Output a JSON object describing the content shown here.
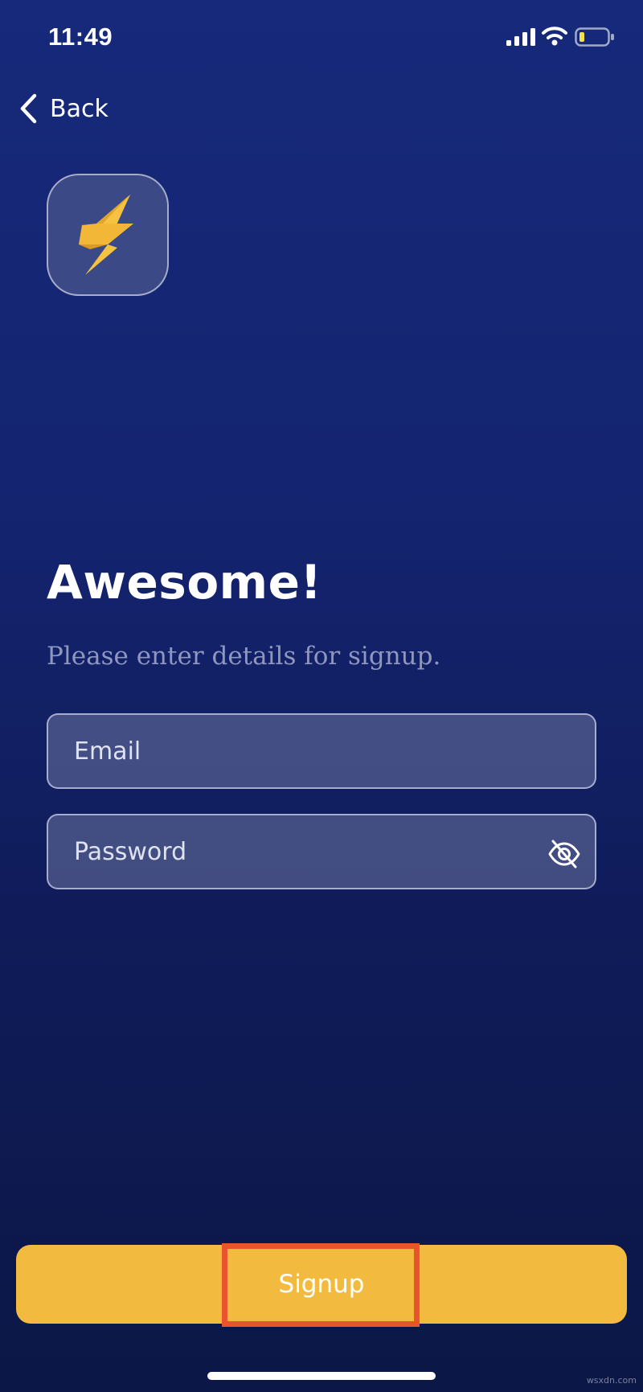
{
  "status_bar": {
    "time": "11:49",
    "icons": [
      "signal-icon",
      "wifi-icon",
      "battery-icon"
    ],
    "battery_color": "#f2e14a"
  },
  "nav": {
    "back_label": "Back",
    "back_icon": "chevron-left-icon"
  },
  "logo": {
    "icon": "lightning-bolt-icon",
    "bolt_color": "#f2b737"
  },
  "main": {
    "headline": "Awesome!",
    "subtitle": "Please enter details for signup."
  },
  "form": {
    "email": {
      "value": "",
      "placeholder": "Email"
    },
    "password": {
      "value": "",
      "placeholder": "Password",
      "toggle_icon": "eye-off-icon"
    }
  },
  "signup_button": {
    "label": "Signup",
    "color": "#f2bb3f"
  },
  "highlight": {
    "color": "#e8542c"
  },
  "watermark": "wsxdn.com"
}
